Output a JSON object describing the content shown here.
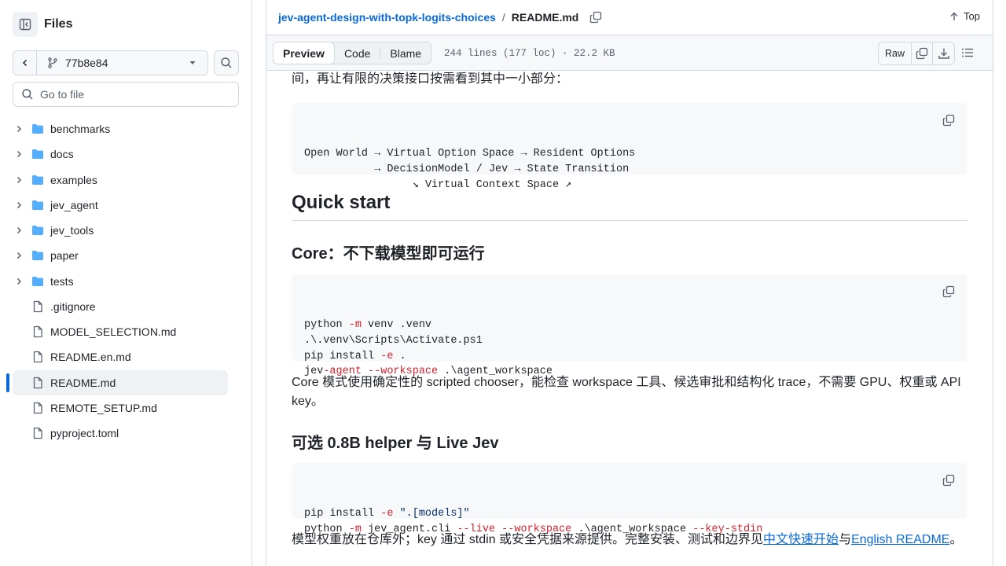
{
  "sidebar": {
    "title": "Files",
    "branch": "77b8e84",
    "goto_placeholder": "Go to file",
    "items": [
      {
        "label": "benchmarks",
        "type": "dir"
      },
      {
        "label": "docs",
        "type": "dir"
      },
      {
        "label": "examples",
        "type": "dir"
      },
      {
        "label": "jev_agent",
        "type": "dir"
      },
      {
        "label": "jev_tools",
        "type": "dir"
      },
      {
        "label": "paper",
        "type": "dir"
      },
      {
        "label": "tests",
        "type": "dir"
      },
      {
        "label": ".gitignore",
        "type": "file"
      },
      {
        "label": "MODEL_SELECTION.md",
        "type": "file"
      },
      {
        "label": "README.en.md",
        "type": "file"
      },
      {
        "label": "README.md",
        "type": "file",
        "active": true
      },
      {
        "label": "REMOTE_SETUP.md",
        "type": "file"
      },
      {
        "label": "pyproject.toml",
        "type": "file"
      }
    ]
  },
  "header": {
    "repo": "jev-agent-design-with-topk-logits-choices",
    "separator": "/",
    "file": "README.md",
    "top_label": "Top"
  },
  "filebar": {
    "tabs": [
      "Preview",
      "Code",
      "Blame"
    ],
    "active_tab": "Preview",
    "stats": "244 lines (177 loc) · 22.2 KB",
    "raw_label": "Raw"
  },
  "content": {
    "intro_tail": "间，再让有限的决策接口按需看到其中一小部分：",
    "diagram_lines": [
      "Open World → Virtual Option Space → Resident Options",
      "           → DecisionModel / Jev → State Transition",
      "                 ↘ Virtual Context Space ↗"
    ],
    "h2_quickstart": "Quick start",
    "h3_core": "Core：不下载模型即可运行",
    "core_code": [
      {
        "cmd": "python",
        "flag": "-m",
        "rest": " venv .venv"
      },
      {
        "cmd": ".\\.venv\\Scripts\\Activate.ps1",
        "flag": "",
        "rest": ""
      },
      {
        "cmd": "pip install",
        "flag": "-e",
        "rest": " ."
      },
      {
        "cmd": "jev",
        "flag": "-agent --workspace",
        "rest": " .\\agent_workspace"
      }
    ],
    "core_para": "Core 模式使用确定性的 scripted chooser，能检查 workspace 工具、候选审批和结构化 trace，不需要 GPU、权重或 API key。",
    "h3_optional": "可选 0.8B helper 与 Live Jev",
    "opt_line1_a": "pip install ",
    "opt_line1_flag": "-e",
    "opt_line1_str": " \".[models]\"",
    "opt_line2_a": "python ",
    "opt_line2_flag1": "-m",
    "opt_line2_b": " jev_agent.cli ",
    "opt_line2_flag2": "--live --workspace",
    "opt_line2_c": " .\\agent_workspace ",
    "opt_line2_flag3": "--key-stdin",
    "final_para_a": "模型权重放在仓库外；key 通过 stdin 或安全凭据来源提供。完整安装、测试和边界见",
    "final_link1": "中文快速开始",
    "final_mid": "与",
    "final_link2": "English README",
    "final_end": "。"
  },
  "colors": {
    "accent": "#0969da",
    "folder": "#54aeff",
    "border": "#d1d9e0"
  }
}
